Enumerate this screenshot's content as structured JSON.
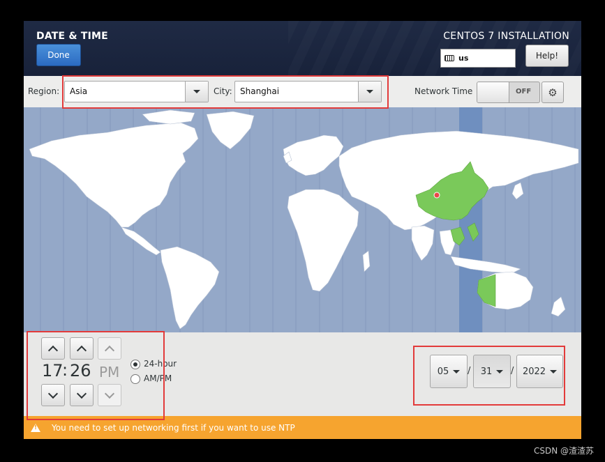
{
  "header": {
    "title": "DATE & TIME",
    "product": "CENTOS 7 INSTALLATION",
    "done_label": "Done",
    "keyboard_layout": "us",
    "help_label": "Help!"
  },
  "toolbar": {
    "region_label": "Region:",
    "region_value": "Asia",
    "city_label": "City:",
    "city_value": "Shanghai",
    "network_time_label": "Network Time",
    "network_time_state": "OFF",
    "settings_icon": "gear-icon"
  },
  "map": {
    "selected_timezone_color": "#7ac95a",
    "highlight_band_color": "#6f8fbf",
    "ocean_color": "#94a8c8",
    "land_color": "#ffffff",
    "marker_color": "#e84848"
  },
  "time": {
    "hours": "17",
    "separator": ":",
    "minutes": "26",
    "ampm": "PM",
    "format_24h_label": "24-hour",
    "format_ampm_label": "AM/PM",
    "format_selected": "24-hour"
  },
  "date": {
    "month": "05",
    "day": "31",
    "year": "2022",
    "separator": "/"
  },
  "banner": {
    "message": "You need to set up networking first if you want to use NTP",
    "icon": "warning-icon",
    "color": "#f6a42f"
  },
  "watermark": "CSDN @渣渣苏"
}
